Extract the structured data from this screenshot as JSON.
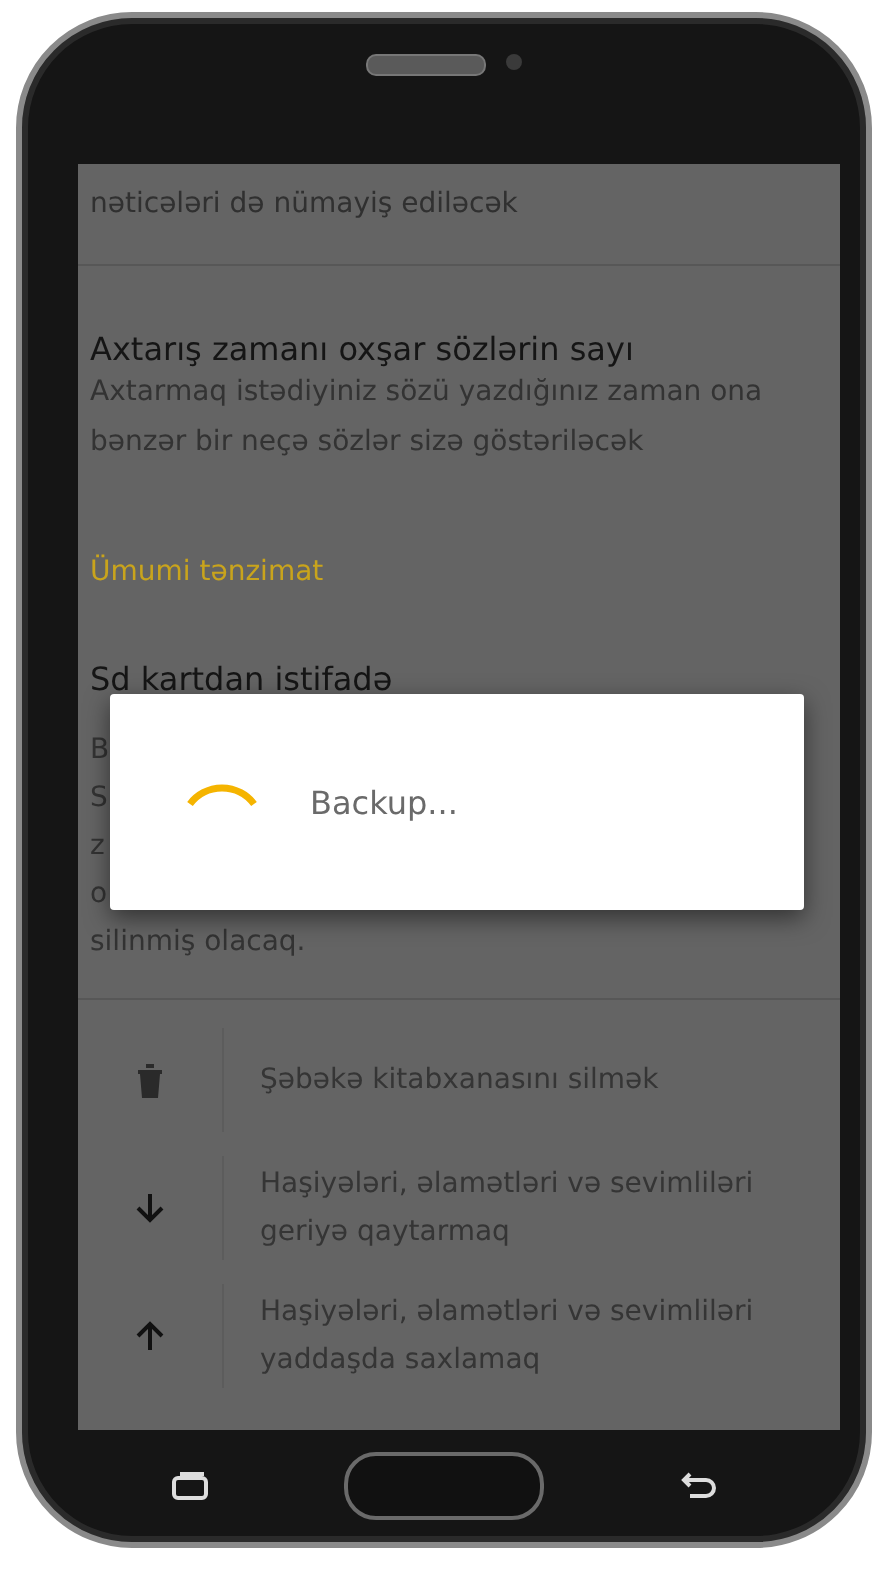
{
  "screen": {
    "top_text": "nəticələri də nümayiş ediləcək",
    "setting": {
      "title": "Axtarış zamanı oxşar sözlərin sayı",
      "description": "Axtarmaq istədiyiniz sözü yazdığınız zaman ona bənzər bir neçə sözlər sizə göstəriləcək"
    },
    "section_header": "Ümumi tənzimat",
    "sd_setting": {
      "title": "Sd kartdan istifadə",
      "visible_description": [
        "B",
        "S",
        "z",
        "o",
        "silinmiş olacaq."
      ]
    },
    "actions": [
      {
        "kind": "delete",
        "label": "Şəbəkə kitabxanasını silmək"
      },
      {
        "kind": "restore",
        "label": "Haşiyələri, əlamətləri və sevimliləri geriyə qaytarmaq"
      },
      {
        "kind": "backup",
        "label": "Haşiyələri, əlamətləri və sevimliləri yaddaşda saxlamaq"
      }
    ]
  },
  "dialog": {
    "message": "Backup..."
  }
}
